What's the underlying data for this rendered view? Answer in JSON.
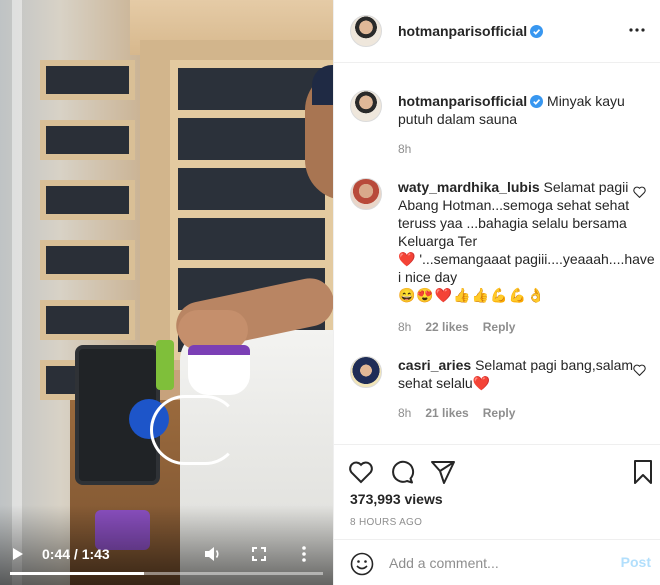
{
  "video": {
    "current_time": "0:44 / 1:43",
    "progress": 0.427,
    "controls": {
      "play_icon": "play-icon",
      "volume_icon": "volume-icon",
      "fullscreen_icon": "fullscreen-icon",
      "more_icon": "more-vertical-icon"
    }
  },
  "header": {
    "username": "hotmanparisofficial",
    "verified": true,
    "more_icon": "more-horizontal-icon"
  },
  "caption": {
    "username": "hotmanparisofficial",
    "text": "Minyak kayu putuh dalam sauna",
    "time": "8h"
  },
  "comments": [
    {
      "username": "waty_mardhika_lubis",
      "line1": "Selamat pagii Abang Hotman...semoga sehat sehat teruss yaa ...bahagia selalu bersama Keluarga Ter",
      "line2_heart": "❤️",
      "line2": "'...semangaaat pagiii....yeaaah....have i nice day",
      "emojis": "😄😍❤️👍👍💪💪👌",
      "time": "8h",
      "likes": "22 likes",
      "reply": "Reply"
    },
    {
      "username": "casri_aries",
      "line1": "Selamat pagi bang,salam sehat selalu",
      "heart": "❤️",
      "time": "8h",
      "likes": "21 likes",
      "reply": "Reply"
    }
  ],
  "actions": {
    "views": "373,993 views",
    "time_ago": "8 HOURS AGO"
  },
  "add_comment": {
    "placeholder": "Add a comment...",
    "post_label": "Post"
  },
  "colors": {
    "verified_blue": "#3897f0",
    "post_disabled": "#b2dffc",
    "heart_red": "#ed4956",
    "meta_gray": "#8e8e8e"
  }
}
